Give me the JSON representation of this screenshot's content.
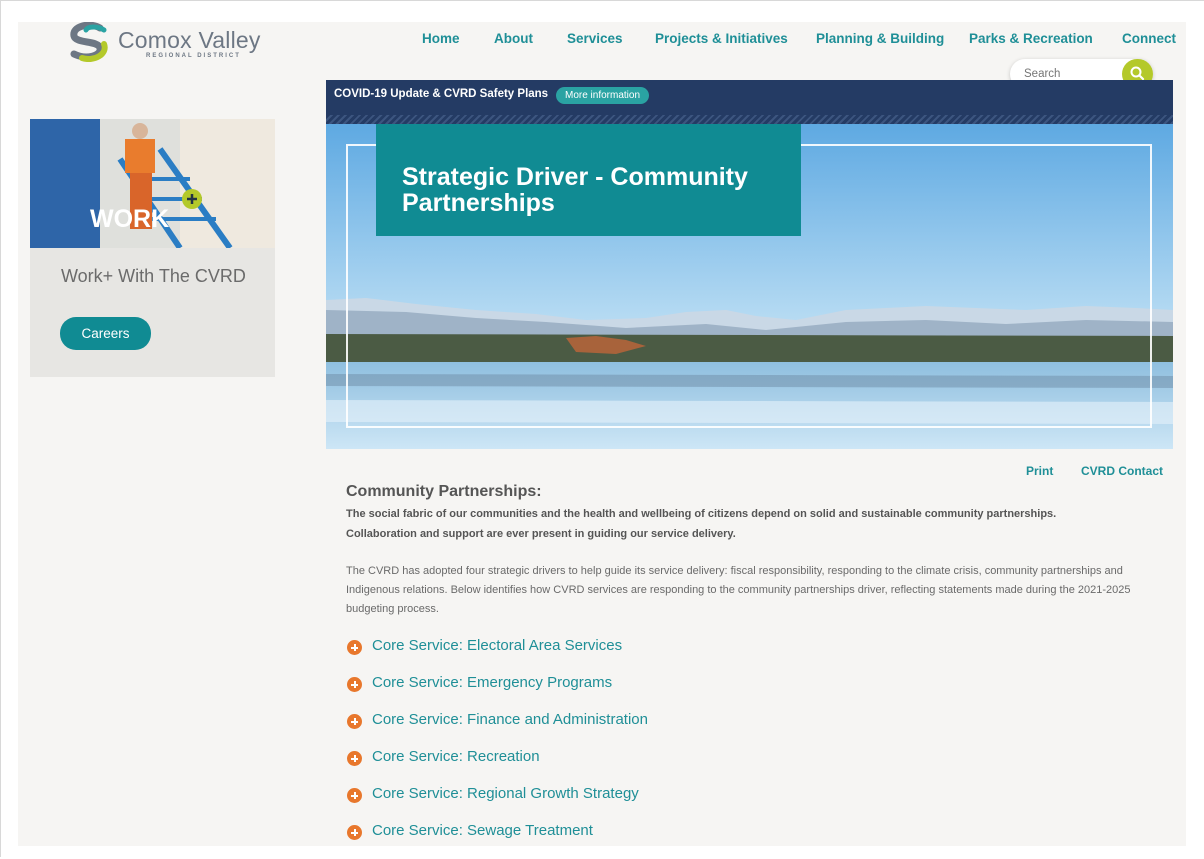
{
  "logo": {
    "name": "Comox Valley",
    "subtitle": "REGIONAL DISTRICT"
  },
  "nav": [
    {
      "label": "Home"
    },
    {
      "label": "About"
    },
    {
      "label": "Services"
    },
    {
      "label": "Projects & Initiatives"
    },
    {
      "label": "Planning & Building"
    },
    {
      "label": "Parks & Recreation"
    },
    {
      "label": "Connect"
    }
  ],
  "search": {
    "placeholder": "Search"
  },
  "covid": {
    "text": "COVID-19 Update & CVRD Safety Plans",
    "button": "More information"
  },
  "hero": {
    "title": "Strategic Driver - Community Partnerships"
  },
  "sidebar": {
    "image_text": "WORK",
    "title": "Work+ With The CVRD",
    "button": "Careers"
  },
  "utility": {
    "print": "Print",
    "contact": "CVRD Contact"
  },
  "content": {
    "heading": "Community Partnerships:",
    "lead": "The social fabric of our communities and the health and wellbeing of citizens depend on solid and sustainable community partnerships. Collaboration and support are ever present in guiding our service delivery.",
    "body": "The CVRD has adopted four strategic drivers to help guide its service delivery: fiscal responsibility, responding to the climate crisis, community partnerships and Indigenous relations. Below identifies how CVRD services are responding to the community partnerships driver, reflecting statements made during the 2021-2025 budgeting process."
  },
  "accordion": [
    {
      "label": "Core Service: Electoral Area Services"
    },
    {
      "label": "Core Service: Emergency Programs"
    },
    {
      "label": "Core Service: Finance and Administration"
    },
    {
      "label": "Core Service: Recreation"
    },
    {
      "label": "Core Service: Regional Growth Strategy"
    },
    {
      "label": "Core Service: Sewage Treatment"
    }
  ],
  "colors": {
    "teal": "#108b93",
    "link": "#1f8f97",
    "navy": "#243b64",
    "orange": "#e8772c",
    "lime": "#b4c92a"
  }
}
